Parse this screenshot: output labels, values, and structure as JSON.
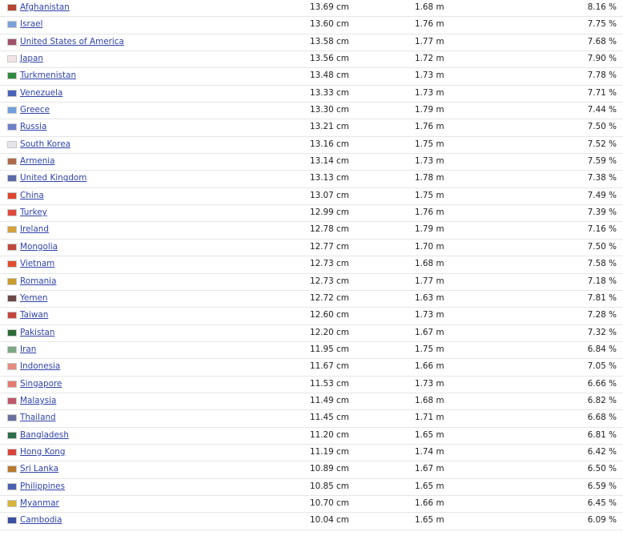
{
  "rows": [
    {
      "country": "Afghanistan",
      "length": "13.69 cm",
      "height": "1.68 m",
      "ratio": "8.16 %",
      "flag": "#b5452d",
      "flag_icon": "afghanistan-flag-icon"
    },
    {
      "country": "Israel",
      "length": "13.60 cm",
      "height": "1.76 m",
      "ratio": "7.75 %",
      "flag": "#7d9fd9",
      "flag_icon": "israel-flag-icon"
    },
    {
      "country": "United States of America",
      "length": "13.58 cm",
      "height": "1.77 m",
      "ratio": "7.68 %",
      "flag": "#a0526a",
      "flag_icon": "usa-flag-icon"
    },
    {
      "country": "Japan",
      "length": "13.56 cm",
      "height": "1.72 m",
      "ratio": "7.90 %",
      "flag": "#f3e5e5",
      "flag_icon": "japan-flag-icon"
    },
    {
      "country": "Turkmenistan",
      "length": "13.48 cm",
      "height": "1.73 m",
      "ratio": "7.78 %",
      "flag": "#2e8b3e",
      "flag_icon": "turkmenistan-flag-icon"
    },
    {
      "country": "Venezuela",
      "length": "13.33 cm",
      "height": "1.73 m",
      "ratio": "7.71 %",
      "flag": "#4a63b8",
      "flag_icon": "venezuela-flag-icon"
    },
    {
      "country": "Greece",
      "length": "13.30 cm",
      "height": "1.79 m",
      "ratio": "7.44 %",
      "flag": "#6f9fdc",
      "flag_icon": "greece-flag-icon"
    },
    {
      "country": "Russia",
      "length": "13.21 cm",
      "height": "1.76 m",
      "ratio": "7.50 %",
      "flag": "#6e7fc9",
      "flag_icon": "russia-flag-icon"
    },
    {
      "country": "South Korea",
      "length": "13.16 cm",
      "height": "1.75 m",
      "ratio": "7.52 %",
      "flag": "#e4e4ea",
      "flag_icon": "south-korea-flag-icon"
    },
    {
      "country": "Armenia",
      "length": "13.14 cm",
      "height": "1.73 m",
      "ratio": "7.59 %",
      "flag": "#b06a4a",
      "flag_icon": "armenia-flag-icon"
    },
    {
      "country": "United Kingdom",
      "length": "13.13 cm",
      "height": "1.78 m",
      "ratio": "7.38 %",
      "flag": "#5a6aa8",
      "flag_icon": "uk-flag-icon"
    },
    {
      "country": "China",
      "length": "13.07 cm",
      "height": "1.75 m",
      "ratio": "7.49 %",
      "flag": "#e0452f",
      "flag_icon": "china-flag-icon"
    },
    {
      "country": "Turkey",
      "length": "12.99 cm",
      "height": "1.76 m",
      "ratio": "7.39 %",
      "flag": "#e04a3c",
      "flag_icon": "turkey-flag-icon"
    },
    {
      "country": "Ireland",
      "length": "12.78 cm",
      "height": "1.79 m",
      "ratio": "7.16 %",
      "flag": "#d4a13a",
      "flag_icon": "ireland-flag-icon"
    },
    {
      "country": "Mongolia",
      "length": "12.77 cm",
      "height": "1.70 m",
      "ratio": "7.50 %",
      "flag": "#c0473d",
      "flag_icon": "mongolia-flag-icon"
    },
    {
      "country": "Vietnam",
      "length": "12.73 cm",
      "height": "1.68 m",
      "ratio": "7.58 %",
      "flag": "#e04d2e",
      "flag_icon": "vietnam-flag-icon"
    },
    {
      "country": "Romania",
      "length": "12.73 cm",
      "height": "1.77 m",
      "ratio": "7.18 %",
      "flag": "#c99c2c",
      "flag_icon": "romania-flag-icon"
    },
    {
      "country": "Yemen",
      "length": "12.72 cm",
      "height": "1.63 m",
      "ratio": "7.81 %",
      "flag": "#6b4a4a",
      "flag_icon": "yemen-flag-icon"
    },
    {
      "country": "Taiwan",
      "length": "12.60 cm",
      "height": "1.73 m",
      "ratio": "7.28 %",
      "flag": "#c5453d",
      "flag_icon": "taiwan-flag-icon"
    },
    {
      "country": "Pakistan",
      "length": "12.20 cm",
      "height": "1.67 m",
      "ratio": "7.32 %",
      "flag": "#2c6b35",
      "flag_icon": "pakistan-flag-icon"
    },
    {
      "country": "Iran",
      "length": "11.95 cm",
      "height": "1.75 m",
      "ratio": "6.84 %",
      "flag": "#7aa882",
      "flag_icon": "iran-flag-icon"
    },
    {
      "country": "Indonesia",
      "length": "11.67 cm",
      "height": "1.66 m",
      "ratio": "7.05 %",
      "flag": "#e48a80",
      "flag_icon": "indonesia-flag-icon"
    },
    {
      "country": "Singapore",
      "length": "11.53 cm",
      "height": "1.73 m",
      "ratio": "6.66 %",
      "flag": "#e57a72",
      "flag_icon": "singapore-flag-icon"
    },
    {
      "country": "Malaysia",
      "length": "11.49 cm",
      "height": "1.68 m",
      "ratio": "6.82 %",
      "flag": "#c0576a",
      "flag_icon": "malaysia-flag-icon"
    },
    {
      "country": "Thailand",
      "length": "11.45 cm",
      "height": "1.71 m",
      "ratio": "6.68 %",
      "flag": "#6a6fa0",
      "flag_icon": "thailand-flag-icon"
    },
    {
      "country": "Bangladesh",
      "length": "11.20 cm",
      "height": "1.65 m",
      "ratio": "6.81 %",
      "flag": "#2f6e4a",
      "flag_icon": "bangladesh-flag-icon"
    },
    {
      "country": "Hong Kong",
      "length": "11.19 cm",
      "height": "1.74 m",
      "ratio": "6.42 %",
      "flag": "#d9453a",
      "flag_icon": "hong-kong-flag-icon"
    },
    {
      "country": "Sri Lanka",
      "length": "10.89 cm",
      "height": "1.67 m",
      "ratio": "6.50 %",
      "flag": "#b8792c",
      "flag_icon": "sri-lanka-flag-icon"
    },
    {
      "country": "Philippines",
      "length": "10.85 cm",
      "height": "1.65 m",
      "ratio": "6.59 %",
      "flag": "#4c62b0",
      "flag_icon": "philippines-flag-icon"
    },
    {
      "country": "Myanmar",
      "length": "10.70 cm",
      "height": "1.66 m",
      "ratio": "6.45 %",
      "flag": "#d9b43a",
      "flag_icon": "myanmar-flag-icon"
    },
    {
      "country": "Cambodia",
      "length": "10.04 cm",
      "height": "1.65 m",
      "ratio": "6.09 %",
      "flag": "#3b4fa0",
      "flag_icon": "cambodia-flag-icon"
    }
  ]
}
